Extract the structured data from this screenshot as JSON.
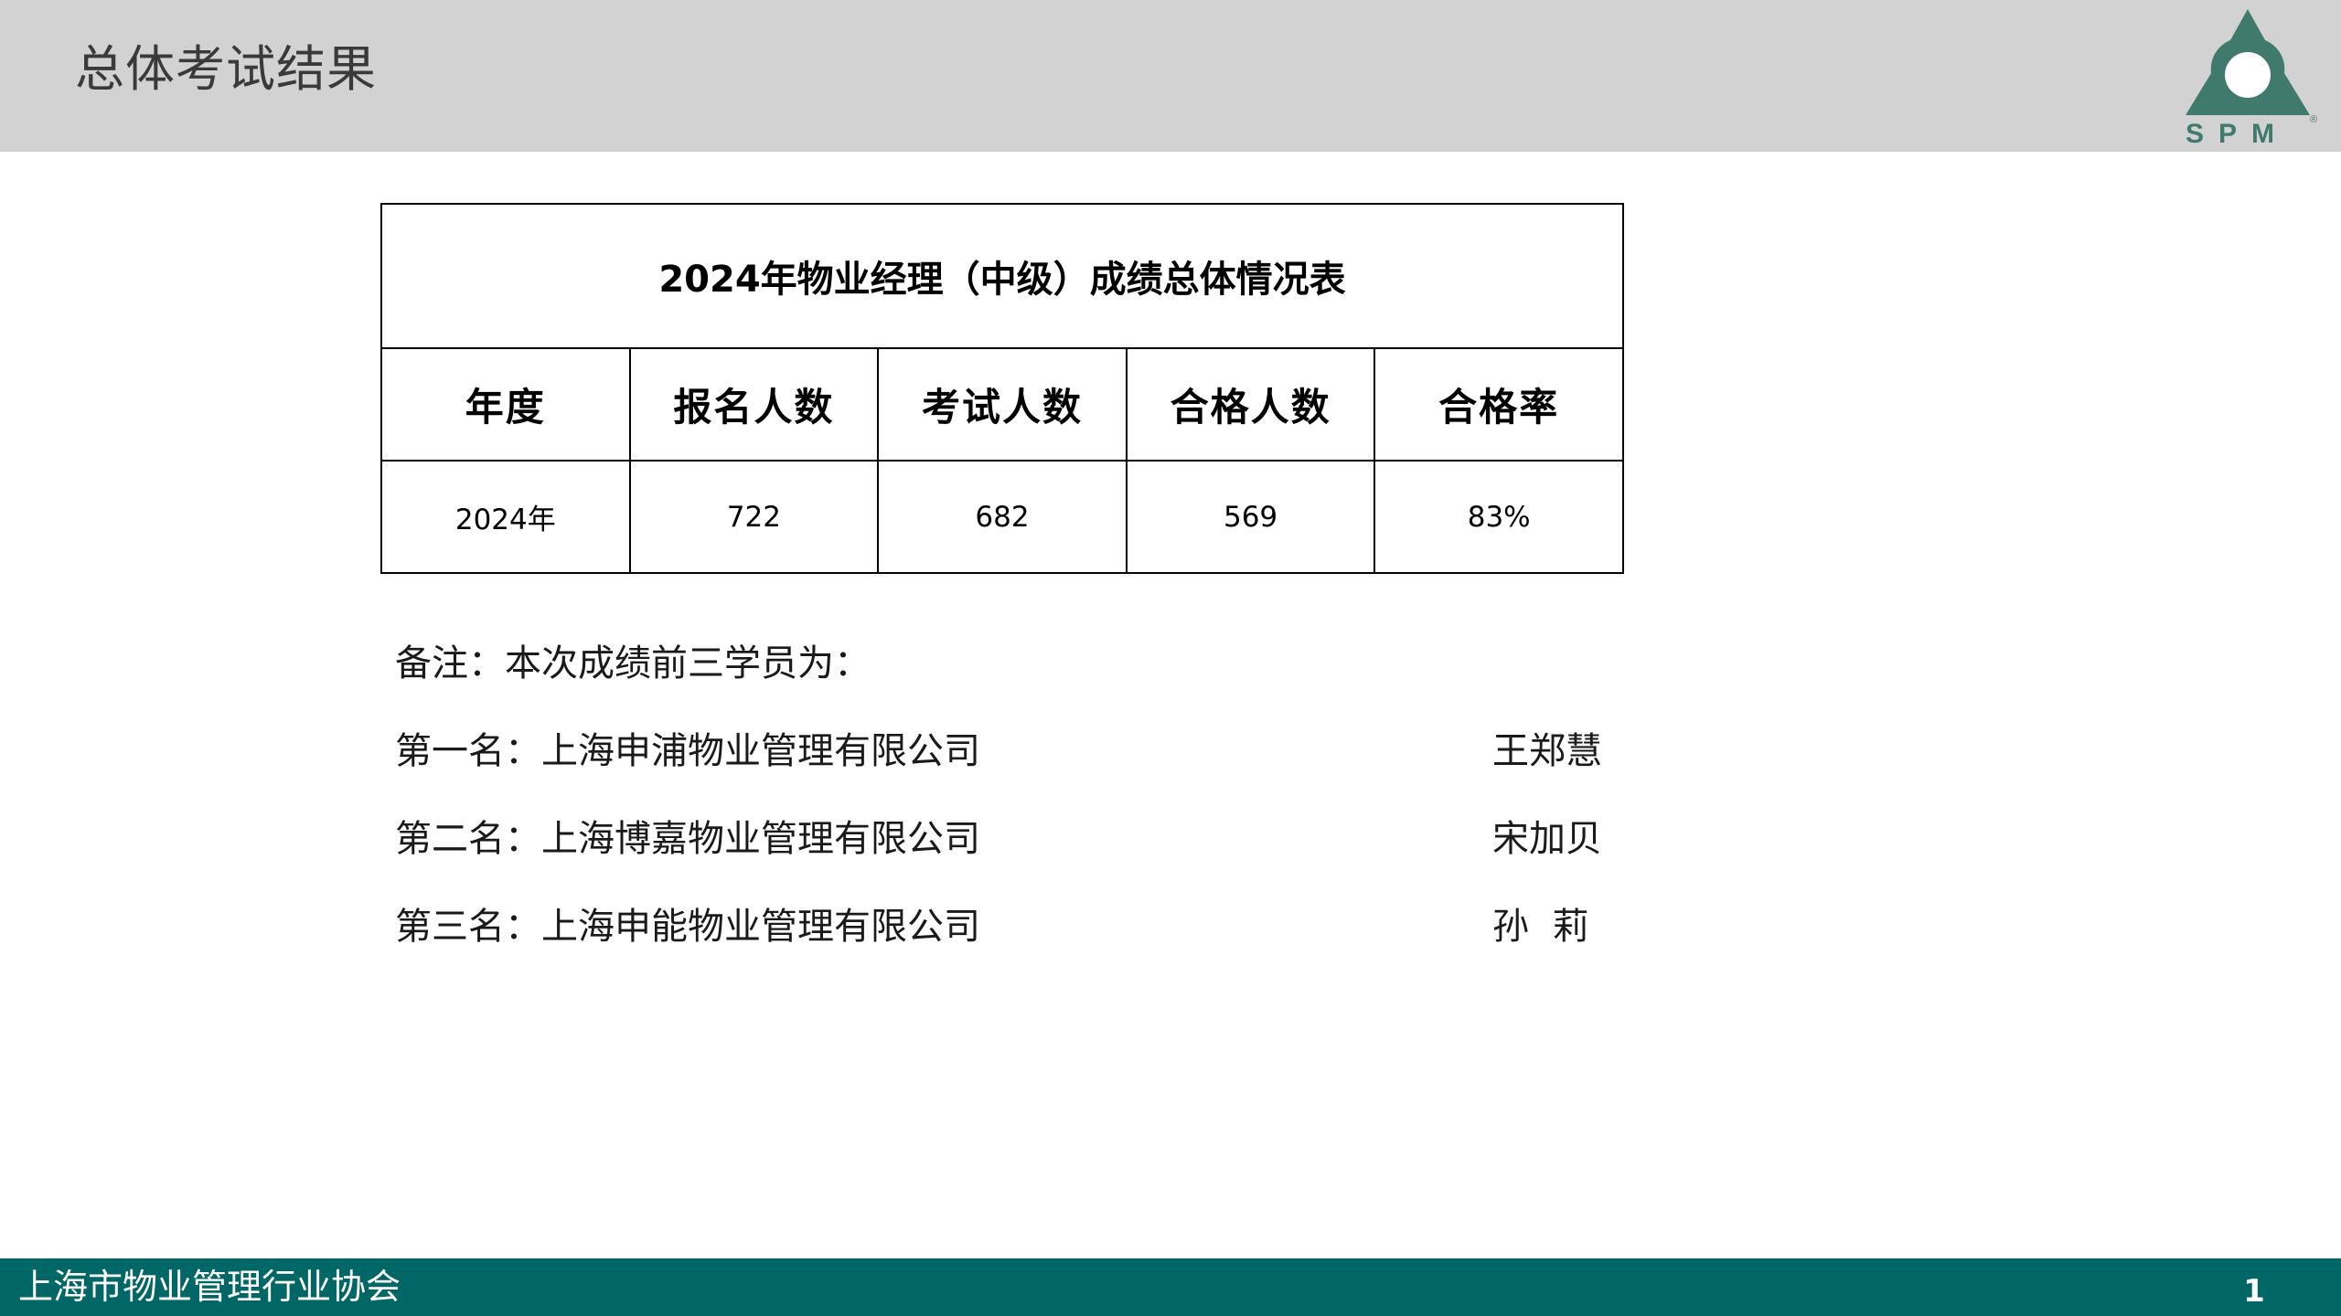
{
  "header": {
    "title": "总体考试结果",
    "logo_text": "SPM",
    "logo_mark": "®",
    "logo_color": "#3f7a6d"
  },
  "table": {
    "caption": "2024年物业经理（中级）成绩总体情况表",
    "headers": [
      "年度",
      "报名人数",
      "考试人数",
      "合格人数",
      "合格率"
    ],
    "row": [
      "2024年",
      "722",
      "682",
      "569",
      "83%"
    ]
  },
  "notes": {
    "title": "备注：本次成绩前三学员为：",
    "winners": [
      {
        "rank_company": "第一名：上海申浦物业管理有限公司",
        "person": "王郑慧"
      },
      {
        "rank_company": "第二名：上海博嘉物业管理有限公司",
        "person": "宋加贝"
      },
      {
        "rank_company": "第三名：上海申能物业管理有限公司",
        "person": "孙  莉"
      }
    ]
  },
  "footer": {
    "organization": "上海市物业管理行业协会",
    "page_number": "1",
    "color": "#006666"
  }
}
